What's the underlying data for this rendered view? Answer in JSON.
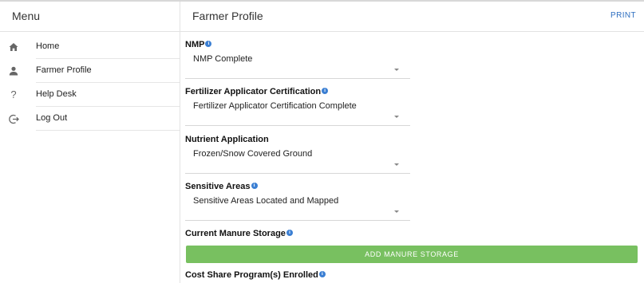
{
  "header": {
    "menu_title": "Menu",
    "page_title": "Farmer Profile",
    "print_label": "PRINT"
  },
  "sidebar": {
    "items": [
      {
        "label": "Home",
        "icon": "home-icon"
      },
      {
        "label": "Farmer Profile",
        "icon": "person-icon"
      },
      {
        "label": "Help Desk",
        "icon": "help-icon"
      },
      {
        "label": "Log Out",
        "icon": "logout-icon"
      }
    ]
  },
  "form": {
    "nmp": {
      "label": "NMP",
      "value": "NMP Complete",
      "has_info": true
    },
    "fertilizer": {
      "label": "Fertilizer Applicator Certification",
      "value": "Fertilizer Applicator Certification Complete",
      "has_info": true
    },
    "nutrient": {
      "label": "Nutrient Application",
      "value": "Frozen/Snow Covered Ground",
      "has_info": false
    },
    "sensitive": {
      "label": "Sensitive Areas",
      "value": "Sensitive Areas Located and Mapped",
      "has_info": true
    },
    "manure": {
      "label": "Current Manure Storage",
      "has_info": true,
      "button_label": "ADD MANURE STORAGE"
    },
    "cost_share": {
      "label": "Cost Share Program(s) Enrolled",
      "has_info": true
    }
  },
  "colors": {
    "accent": "#2f6fc0",
    "info": "#3b7fd3",
    "button": "#78c060"
  }
}
